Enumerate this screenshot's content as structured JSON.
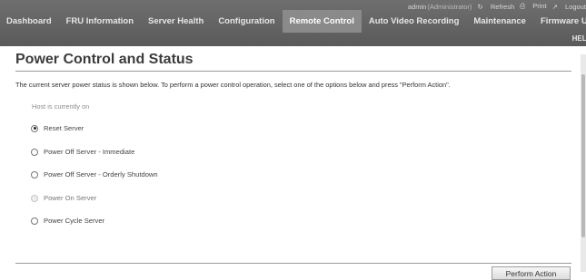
{
  "utility": {
    "user": "admin",
    "role": "(Administrator)",
    "refresh": "Refresh",
    "print": "Print",
    "logout": "Logout"
  },
  "nav": {
    "items": [
      "Dashboard",
      "FRU Information",
      "Server Health",
      "Configuration",
      "Remote Control",
      "Auto Video Recording",
      "Maintenance",
      "Firmware Update"
    ],
    "active": "Remote Control",
    "help": "HELP"
  },
  "main": {
    "title": "Power Control and Status",
    "description": "The current server power status is shown below. To perform a power control operation, select one of the options below and press \"Perform Action\".",
    "status": "Host is currently on",
    "options": [
      {
        "label": "Reset Server",
        "selected": true,
        "disabled": false
      },
      {
        "label": "Power Off Server - Immediate",
        "selected": false,
        "disabled": false
      },
      {
        "label": "Power Off Server - Orderly Shutdown",
        "selected": false,
        "disabled": false
      },
      {
        "label": "Power On Server",
        "selected": false,
        "disabled": true
      },
      {
        "label": "Power Cycle Server",
        "selected": false,
        "disabled": false
      }
    ],
    "action_button": "Perform Action"
  }
}
